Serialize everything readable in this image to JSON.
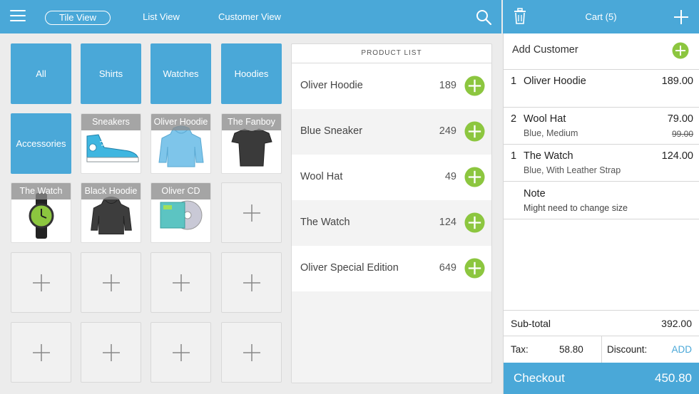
{
  "header": {
    "tabs": [
      {
        "label": "Tile View",
        "active": true
      },
      {
        "label": "List View",
        "active": false
      },
      {
        "label": "Customer View",
        "active": false
      }
    ],
    "menu_icon": "hamburger-icon",
    "search_icon": "search-icon"
  },
  "cart_header": {
    "title": "Cart (5)",
    "trash_icon": "trash-icon",
    "add_icon": "plus-icon"
  },
  "tiles": {
    "categories": [
      "All",
      "Shirts",
      "Watches",
      "Hoodies",
      "Accessories"
    ],
    "products": [
      "Sneakers",
      "Oliver Hoodie",
      "The Fanboy",
      "The Watch",
      "Black Hoodie",
      "Oliver CD"
    ],
    "empty_slots": 9
  },
  "product_list": {
    "header": "PRODUCT LIST",
    "items": [
      {
        "name": "Oliver Hoodie",
        "price": "189"
      },
      {
        "name": "Blue Sneaker",
        "price": "249"
      },
      {
        "name": "Wool Hat",
        "price": "49"
      },
      {
        "name": "The Watch",
        "price": "124"
      },
      {
        "name": "Oliver Special Edition",
        "price": "649"
      }
    ]
  },
  "cart": {
    "add_customer": "Add Customer",
    "lines": [
      {
        "qty": "1",
        "name": "Oliver Hoodie",
        "price": "189.00",
        "detail": "",
        "old_price": ""
      },
      {
        "qty": "2",
        "name": "Wool Hat",
        "price": "79.00",
        "detail": "Blue, Medium",
        "old_price": "99.00"
      },
      {
        "qty": "1",
        "name": "The Watch",
        "price": "124.00",
        "detail": "Blue, With Leather Strap",
        "old_price": ""
      }
    ],
    "note_label": "Note",
    "note_text": "Might need to change size",
    "subtotal_label": "Sub-total",
    "subtotal_value": "392.00",
    "tax_label": "Tax:",
    "tax_value": "58.80",
    "discount_label": "Discount:",
    "discount_action": "ADD",
    "checkout_label": "Checkout",
    "checkout_value": "450.80"
  },
  "colors": {
    "brand_blue": "#4aa8d8",
    "add_green": "#8cc63f"
  }
}
